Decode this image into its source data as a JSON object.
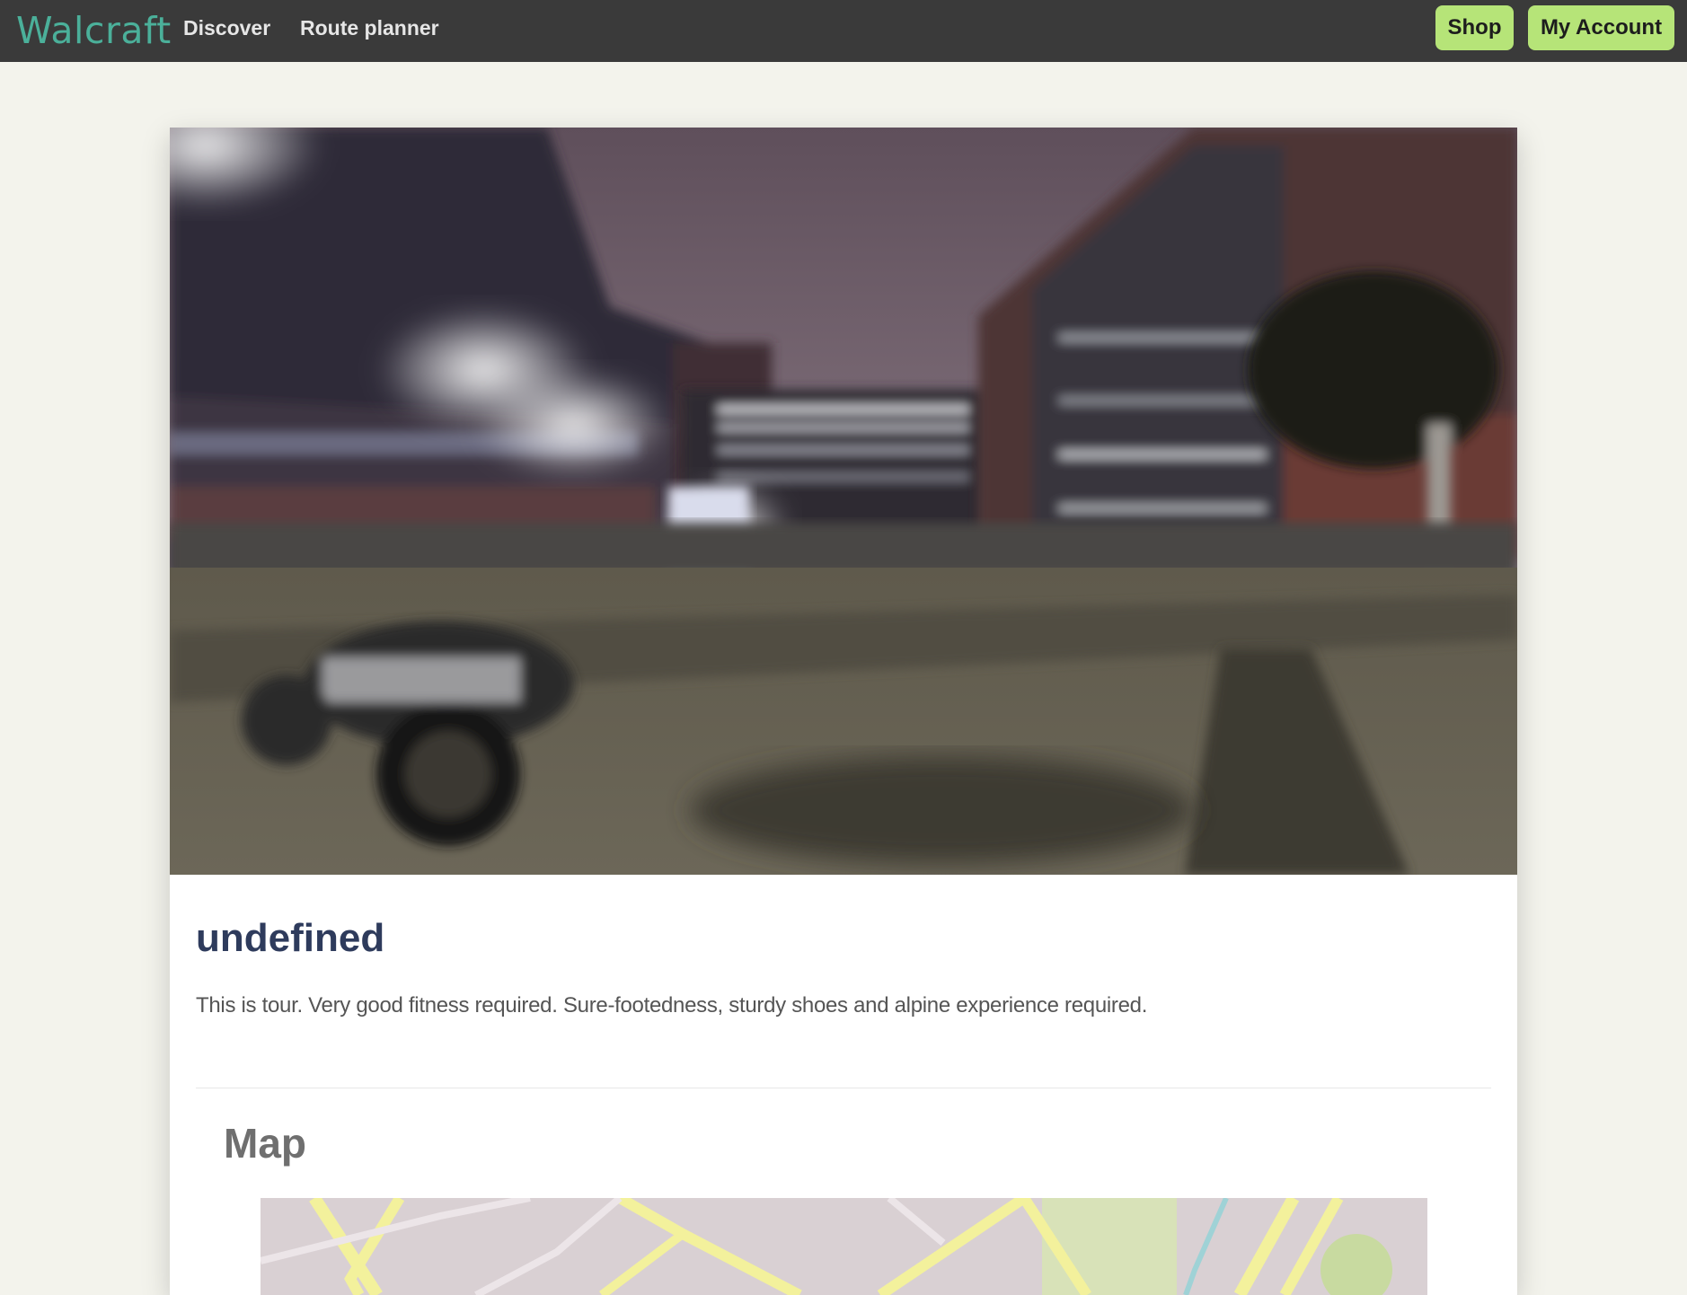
{
  "navbar": {
    "brand": "Walcraft",
    "links": [
      "Discover",
      "Route planner"
    ],
    "shop_label": "Shop",
    "account_label": "My Account"
  },
  "tour": {
    "title": "undefined",
    "description": "This is tour. Very good fitness required. Sure-footedness, sturdy shoes and alpine experience required."
  },
  "map_section": {
    "heading": "Map"
  },
  "colors": {
    "navbar_bg": "#3a3a3a",
    "brand": "#4bb09a",
    "button_bg": "#b6e478",
    "title": "#2e3b5c",
    "page_bg": "#f3f3ec"
  }
}
